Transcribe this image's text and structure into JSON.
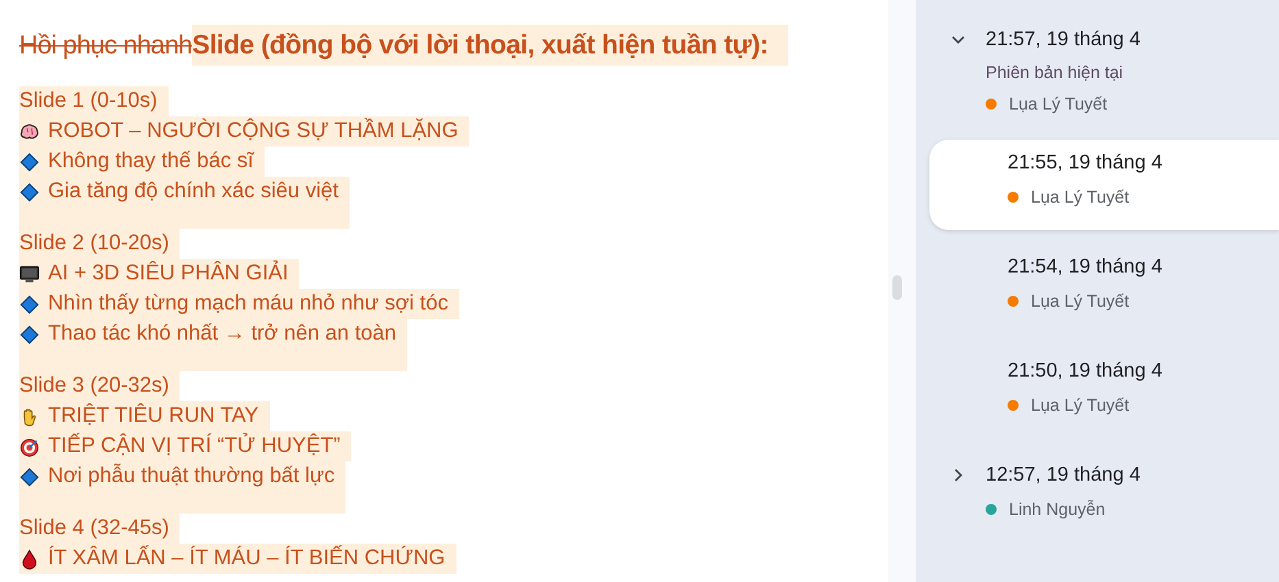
{
  "document": {
    "title_struck": "Hồi phục nhanh",
    "title": "Slide (đồng bộ với lời thoại, xuất hiện tuần tự):",
    "slides": [
      {
        "heading": "Slide 1 (0-10s)",
        "lines": [
          {
            "kind": "brain",
            "text": "ROBOT – NGƯỜI CỘNG SỰ THẦM LẶNG "
          },
          {
            "kind": "diamond",
            "text": "Không thay thế bác sĩ "
          },
          {
            "kind": "diamond",
            "text": "Gia tăng độ chính xác siêu việt "
          }
        ]
      },
      {
        "heading": "Slide 2 (10-20s)",
        "lines": [
          {
            "kind": "monitor",
            "text": "AI + 3D SIÊU PHÂN GIẢI "
          },
          {
            "kind": "diamond",
            "text": "Nhìn thấy từng mạch máu nhỏ như sợi tóc "
          },
          {
            "kind": "diamond",
            "text": "Thao tác khó nhất → trở nên an toàn "
          }
        ]
      },
      {
        "heading": "Slide 3 (20-32s)",
        "lines": [
          {
            "kind": "hand",
            "text": "TRIỆT TIÊU RUN TAY "
          },
          {
            "kind": "target",
            "text": "TIẾP CẬN VỊ TRÍ “TỬ HUYỆT” "
          },
          {
            "kind": "diamond",
            "text": "Nơi phẫu thuật thường bất lực "
          }
        ]
      },
      {
        "heading": "Slide 4 (32-45s)",
        "lines": [
          {
            "kind": "drop",
            "text": "ÍT XÂM LẤN – ÍT MÁU – ÍT BIẾN CHỨNG "
          }
        ]
      }
    ]
  },
  "versions": [
    {
      "time": "21:57, 19 tháng 4",
      "expanded": true,
      "selected": false,
      "subtitle": "Phiên bản hiện tại",
      "author": "Lụa Lý Tuyết",
      "color": "#f57c00",
      "children": [
        {
          "time": "21:55, 19 tháng 4",
          "selected": true,
          "author": "Lụa Lý Tuyết",
          "color": "#f57c00"
        },
        {
          "time": "21:54, 19 tháng 4",
          "selected": false,
          "author": "Lụa Lý Tuyết",
          "color": "#f57c00"
        },
        {
          "time": "21:50, 19 tháng 4",
          "selected": false,
          "author": "Lụa Lý Tuyết",
          "color": "#f57c00"
        }
      ]
    },
    {
      "time": "12:57, 19 tháng 4",
      "expanded": false,
      "selected": false,
      "author": "Linh Nguyễn",
      "color": "#26a69a"
    }
  ]
}
